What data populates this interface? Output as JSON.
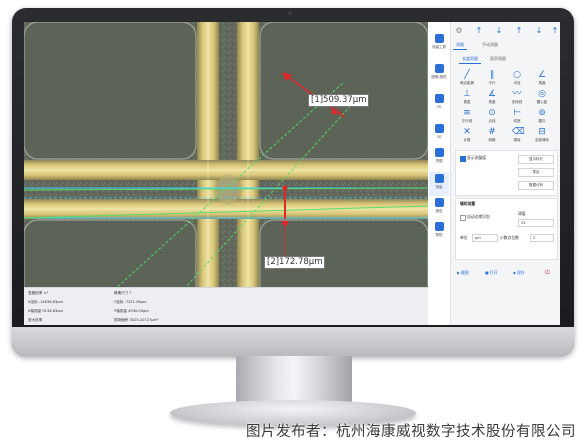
{
  "screen": {
    "measure_labels": {
      "diagonal": "[1]509.37μm",
      "vertical": "[2]172.78μm"
    }
  },
  "sidebar": {
    "tools": [
      {
        "label": "测量工具",
        "icon": "ruler-icon"
      },
      {
        "label": "图像/相机",
        "icon": "camera-icon"
      },
      {
        "label": "2D",
        "icon": "2d-icon"
      },
      {
        "label": "3D",
        "icon": "3d-icon"
      },
      {
        "label": "拼图",
        "icon": "stitch-icon"
      },
      {
        "label": "测量",
        "icon": "measure-icon"
      },
      {
        "label": "报告",
        "icon": "report-icon"
      },
      {
        "label": "帮助",
        "icon": "help-icon"
      }
    ]
  },
  "panel": {
    "tabs": [
      "测量",
      "手动测量"
    ],
    "subtabs": [
      "长度测量",
      "面积测量"
    ],
    "measure_tools": [
      {
        "label": "两点距离",
        "glyph": "╱"
      },
      {
        "label": "平行",
        "glyph": "∥"
      },
      {
        "label": "半径",
        "glyph": "○"
      },
      {
        "label": "角度",
        "glyph": "∠"
      },
      {
        "label": "垂直",
        "glyph": "⊥"
      },
      {
        "label": "角度",
        "glyph": "∡"
      },
      {
        "label": "多段线",
        "glyph": "〰"
      },
      {
        "label": "圆心距",
        "glyph": "◎"
      },
      {
        "label": "平行线",
        "glyph": "≡"
      },
      {
        "label": "点线",
        "glyph": "⊙"
      },
      {
        "label": "线宽",
        "glyph": "⊢"
      },
      {
        "label": "圆孔",
        "glyph": "⊚"
      },
      {
        "label": "计数",
        "glyph": "✕"
      },
      {
        "label": "网格",
        "glyph": "#"
      },
      {
        "label": "清除",
        "glyph": "⌫"
      },
      {
        "label": "全部清除",
        "glyph": "⊟"
      }
    ],
    "show_label": "显示测量值",
    "buttons": [
      "显示标尺",
      "导出",
      "数据分析"
    ],
    "aux_title": "辅助测量",
    "auto_edge": "自动边缘识别",
    "threshold_label": "阈值",
    "threshold_value": "25",
    "unit_label": "单位",
    "unit_value": "μm",
    "decimals_label": "小数点位数",
    "decimals_value": "2",
    "bottom_actions": [
      "截图",
      "打开",
      "保存"
    ]
  },
  "status": {
    "row1": [
      "显微倍率 ×?",
      "像素尺寸 ?"
    ],
    "row2": [
      "X坐标 -14836.83μm",
      "Y坐标 -7321.56μm"
    ],
    "row3": [
      "X轴测量 9134.83μm",
      "Y轴测量 4930.00μm"
    ],
    "row4": [
      "放大倍率",
      "视场面积 3025.20727μm²"
    ]
  },
  "caption": "图片发布者：杭州海康威视数字技术股份有限公司"
}
